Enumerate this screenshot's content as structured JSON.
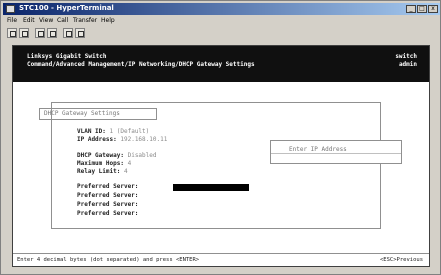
{
  "window": {
    "title": "STC100 - HyperTerminal",
    "min_glyph": "_",
    "max_glyph": "□",
    "close_glyph": "x"
  },
  "menu": [
    "File",
    "Edit",
    "View",
    "Call",
    "Transfer",
    "Help"
  ],
  "toolbar": [
    "new-icon",
    "open-icon",
    "phone-icon",
    "disconnect-icon",
    "send-icon",
    "properties-icon"
  ],
  "header": {
    "title": "Linksys Gigabit Switch",
    "path": "Command/Advanced Management/IP Networking/DHCP Gateway Settings",
    "device": "switch",
    "user": "admin"
  },
  "panel": {
    "title": "DHCP Gateway Settings",
    "vlan_id_label": "VLAN ID:",
    "vlan_id_value": "1 (Default)",
    "ip_label": "IP Address:",
    "ip_value": "192.168.10.11",
    "gateway_label": "DHCP Gateway:",
    "gateway_value": "Disabled",
    "max_hops_label": "Maximum Hops:",
    "max_hops_value": "4",
    "relay_label": "Relay Limit:",
    "relay_value": "4",
    "servers": [
      {
        "label": "Preferred Server:"
      },
      {
        "label": "Preferred Server:"
      },
      {
        "label": "Preferred Server:"
      },
      {
        "label": "Preferred Server:"
      }
    ]
  },
  "prompt": {
    "text": "Enter IP Address"
  },
  "status": {
    "left": "Enter 4 decimal bytes (dot separated) and press <ENTER>",
    "right": "<ESC>Previous"
  }
}
